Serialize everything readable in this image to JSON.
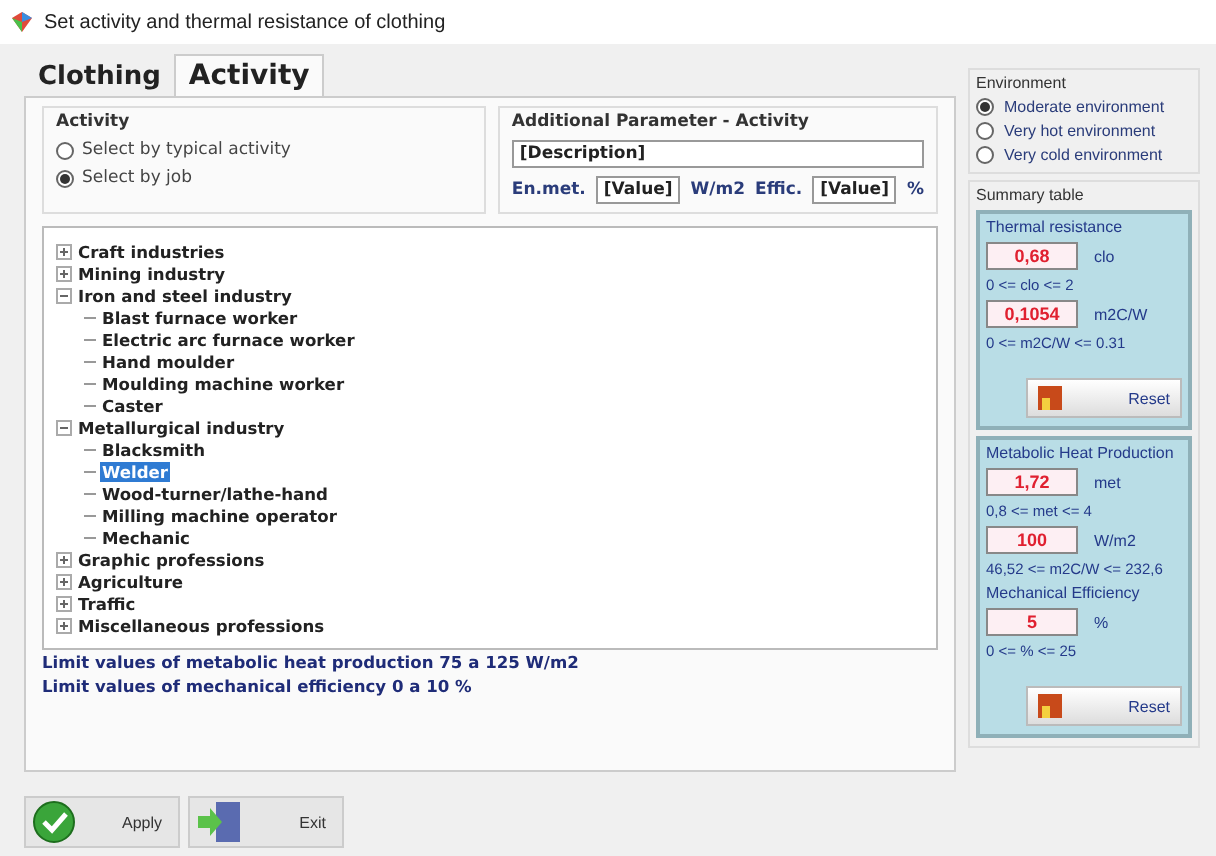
{
  "window": {
    "title": "Set activity and thermal resistance of clothing"
  },
  "tabs": [
    {
      "label": "Clothing",
      "selected": false
    },
    {
      "label": "Activity",
      "selected": true
    }
  ],
  "activity_group": {
    "title": "Activity",
    "options": [
      {
        "label": "Select by typical activity",
        "selected": false
      },
      {
        "label": "Select by job",
        "selected": true
      }
    ]
  },
  "additional_parameter": {
    "title": "Additional Parameter - Activity",
    "description": "[Description]",
    "en_met_label": "En.met.",
    "en_met_value": "[Value]",
    "en_met_unit": "W/m2",
    "effic_label": "Effic.",
    "effic_value": "[Value]",
    "effic_unit": "%"
  },
  "job_tree": [
    {
      "label": "Craft industries",
      "expanded": false,
      "selected": false
    },
    {
      "label": "Mining industry",
      "expanded": false,
      "selected": false
    },
    {
      "label": "Iron and steel industry",
      "expanded": true,
      "selected": false,
      "children": [
        {
          "label": "Blast furnace worker",
          "selected": false
        },
        {
          "label": "Electric arc furnace worker",
          "selected": false
        },
        {
          "label": "Hand moulder",
          "selected": false
        },
        {
          "label": "Moulding machine worker",
          "selected": false
        },
        {
          "label": "Caster",
          "selected": false
        }
      ]
    },
    {
      "label": "Metallurgical industry",
      "expanded": true,
      "selected": false,
      "children": [
        {
          "label": "Blacksmith",
          "selected": false
        },
        {
          "label": "Welder",
          "selected": true
        },
        {
          "label": "Wood-turner/lathe-hand",
          "selected": false
        },
        {
          "label": "Milling machine operator",
          "selected": false
        },
        {
          "label": "Mechanic",
          "selected": false
        }
      ]
    },
    {
      "label": "Graphic professions",
      "expanded": false,
      "selected": false
    },
    {
      "label": "Agriculture",
      "expanded": false,
      "selected": false
    },
    {
      "label": "Traffic",
      "expanded": false,
      "selected": false
    },
    {
      "label": "Miscellaneous professions",
      "expanded": false,
      "selected": false
    }
  ],
  "limits": [
    "Limit values of metabolic heat production 75 a 125 W/m2",
    "Limit values of mechanical efficiency 0 a 10 %"
  ],
  "environment": {
    "title": "Environment",
    "options": [
      {
        "label": "Moderate environment",
        "selected": true
      },
      {
        "label": "Very hot environment",
        "selected": false
      },
      {
        "label": "Very cold environment",
        "selected": false
      }
    ]
  },
  "summary_table": {
    "title": "Summary table",
    "sections": [
      {
        "rows": [
          {
            "kind": "heading",
            "text": "Thermal resistance"
          },
          {
            "kind": "field",
            "value": "0,68",
            "unit": "clo"
          },
          {
            "kind": "range",
            "text": "0 <= clo <= 2"
          },
          {
            "kind": "field",
            "value": "0,1054",
            "unit": "m2C/W"
          },
          {
            "kind": "range",
            "text": "0 <= m2C/W <= 0.31"
          },
          {
            "kind": "button",
            "label": "Reset"
          }
        ]
      },
      {
        "rows": [
          {
            "kind": "heading",
            "text": "Metabolic Heat Production"
          },
          {
            "kind": "field",
            "value": "1,72",
            "unit": "met"
          },
          {
            "kind": "range",
            "text": "0,8 <= met <= 4"
          },
          {
            "kind": "field",
            "value": "100",
            "unit": "W/m2"
          },
          {
            "kind": "range",
            "text": "46,52 <= m2C/W <= 232,6"
          },
          {
            "kind": "heading",
            "text": "Mechanical Efficiency"
          },
          {
            "kind": "field",
            "value": "5",
            "unit": "%"
          },
          {
            "kind": "range",
            "text": "0 <= % <= 25"
          },
          {
            "kind": "button",
            "label": "Reset"
          }
        ]
      }
    ]
  },
  "buttons": [
    {
      "kind": "apply",
      "label": "Apply"
    },
    {
      "kind": "exit",
      "label": "Exit"
    }
  ]
}
